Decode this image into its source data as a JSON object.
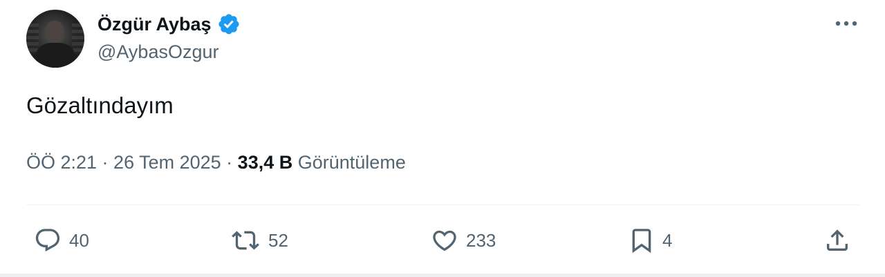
{
  "author": {
    "display_name": "Özgür Aybaş",
    "handle": "@AybasOzgur",
    "verified": true
  },
  "tweet": {
    "text": "Gözaltındayım",
    "time_date": "ÖÖ 2:21 · 26 Tem 2025 · ",
    "views_count": "33,4 B",
    "views_label": "Görüntüleme"
  },
  "actions": {
    "reply_count": "40",
    "retweet_count": "52",
    "like_count": "233",
    "bookmark_count": "4"
  },
  "colors": {
    "accent_blue": "#1d9bf0",
    "text_primary": "#0f1419",
    "text_secondary": "#536471"
  },
  "icons": {
    "verified": "verified-badge-icon",
    "more": "more-options-icon",
    "reply": "reply-icon",
    "retweet": "retweet-icon",
    "like": "heart-icon",
    "bookmark": "bookmark-icon",
    "share": "share-icon"
  }
}
